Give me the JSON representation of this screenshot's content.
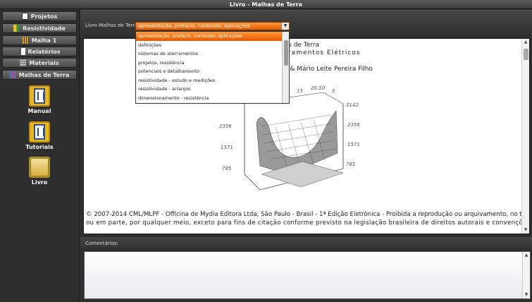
{
  "window": {
    "title": "Livro - Malhas de Terra"
  },
  "sidebar": {
    "nav": [
      {
        "label": "Projetos",
        "icon": "document-icon"
      },
      {
        "label": "Resistividade",
        "icon": "resistivity-icon"
      },
      {
        "label": "Malha 1",
        "icon": "mesh-icon"
      },
      {
        "label": "Relatórios",
        "icon": "report-icon"
      },
      {
        "label": "Materiais",
        "icon": "materials-icon"
      },
      {
        "label": "Malhas de Terra",
        "icon": "grid-icon"
      }
    ],
    "tools": [
      {
        "label": "Manual",
        "icon": "manual-icon"
      },
      {
        "label": "Tutoriais",
        "icon": "tutorials-icon"
      },
      {
        "label": "Livro",
        "icon": "book-icon"
      }
    ]
  },
  "main": {
    "field_label": "Livro Malhas de Terra:",
    "selected": "apresentação, prefácio, conteúdo, aplicações",
    "options": [
      "apresentação, prefácio, conteúdo, aplicações",
      "definições",
      "sistemas de aterramentos",
      "projetos, resistência",
      "potenciais e detalhamento",
      "resistividade - estudo e medições",
      "resistividade - arranjos",
      "dimensionamento - resistência"
    ],
    "doc": {
      "line1": "has de Terra",
      "line2": "erramentos Elétricos",
      "authors": "e & Mário Leite Pereira Filho",
      "copyright1": "© 2007-2014 CML/MLPF - Officina de Mydia Editora Ltda, São Paulo - Brasil - 1ª Edição Eletrônica - Proibida a reprodução ou arquivamento, no todo",
      "copyright2": "ou em parte, por qualquer meio, exceto para fins de citação conforme previsto na legislação brasileira de direitos autorais e convenções",
      "plot_ticks": [
        "3142",
        "2356",
        "1571",
        "785",
        "15",
        "20.10",
        "5",
        "3142",
        "2356",
        "1571",
        "785"
      ]
    },
    "comments_label": "Comentários:"
  },
  "colors": {
    "accent": "#ff7a1a",
    "panel": "#2e2e2e"
  }
}
